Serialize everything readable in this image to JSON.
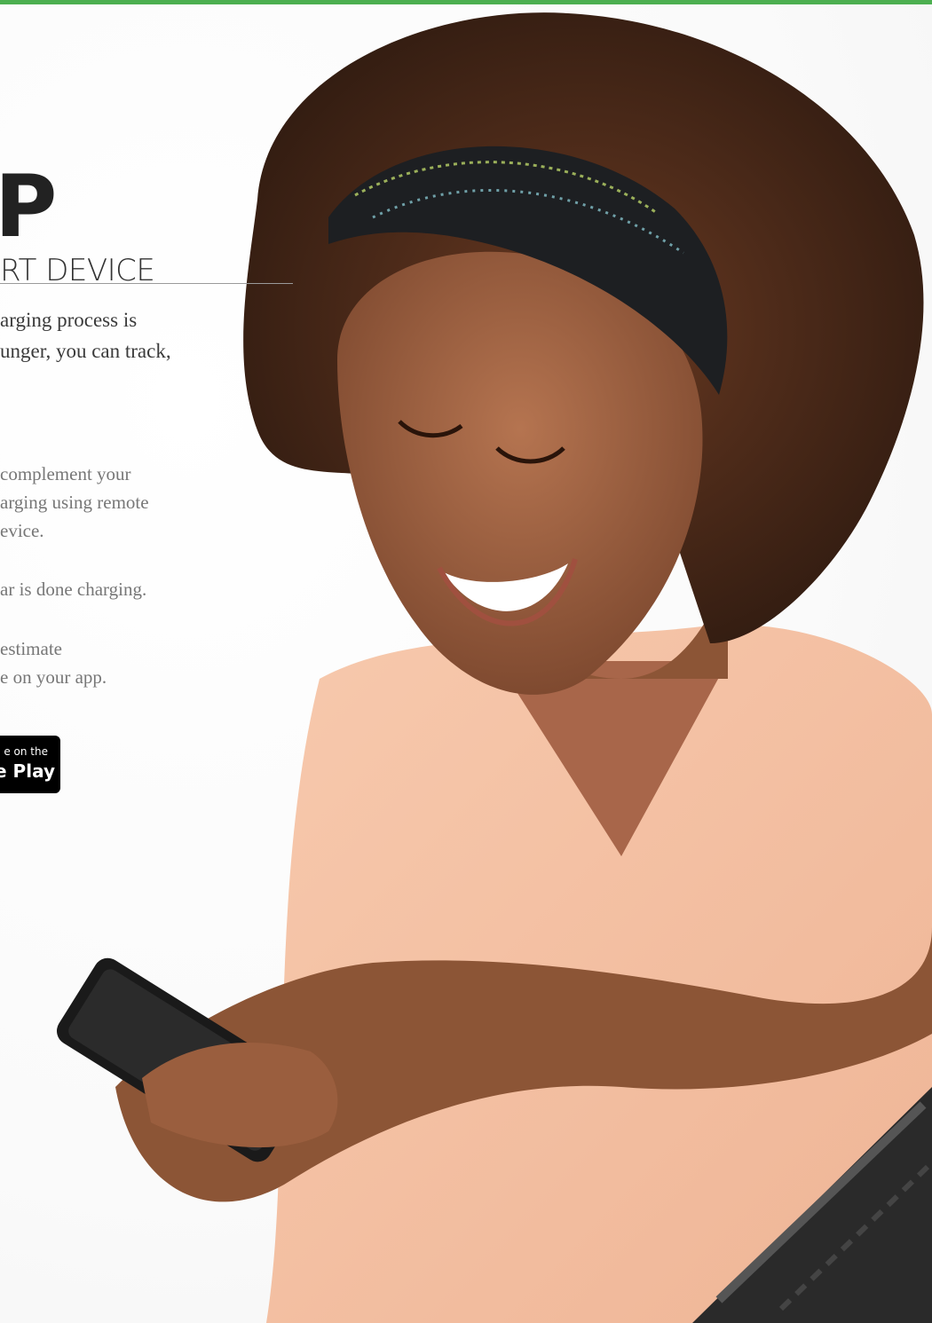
{
  "heading": {
    "title": "P",
    "subtitle": "RT DEVICE"
  },
  "intro": {
    "lines": [
      "arging process is",
      "unger, you can track,"
    ]
  },
  "features": [
    {
      "lines": [
        "complement your",
        "arging using remote",
        "evice."
      ]
    },
    {
      "lines": [
        "ar is done charging."
      ]
    },
    {
      "lines": [
        "estimate",
        "e on your app."
      ]
    }
  ],
  "store_badge": {
    "top_text": "e on the",
    "bottom_text": "e Play"
  },
  "colors": {
    "accent_bar": "#4caf50",
    "badge_bg": "#000000",
    "body_text": "#3a3a3a",
    "muted_text": "#777777"
  }
}
